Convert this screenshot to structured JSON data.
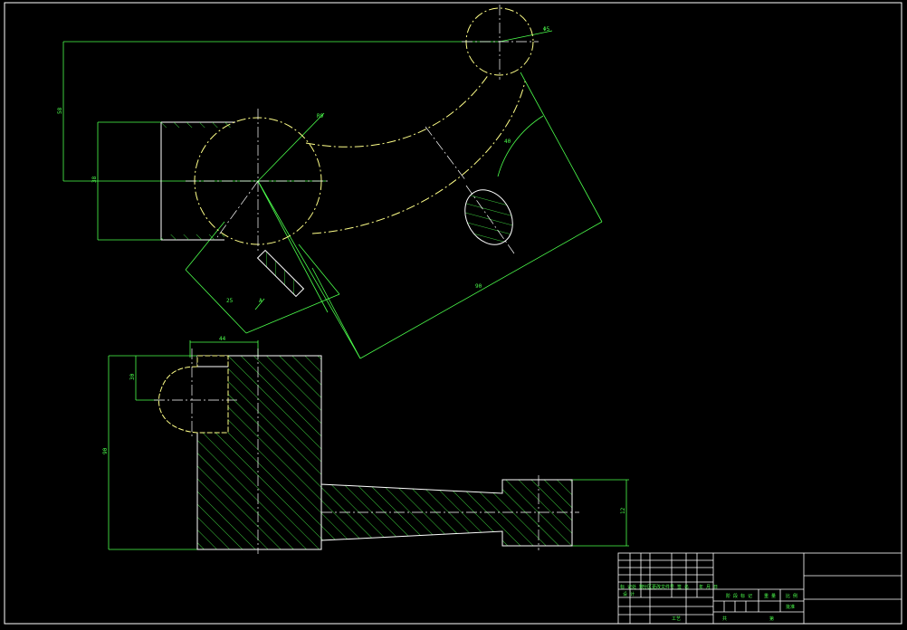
{
  "dimensions": {
    "hole_dia": "Φ5",
    "radius_top": "R9",
    "height_upper": "58",
    "height_boss": "38",
    "angle_arm": "40",
    "length_diag": "90",
    "length_short": "25",
    "view_label": "A",
    "width_top": "44",
    "slot_height": "30",
    "height_lower": "90",
    "shaft_dia": "12"
  },
  "title_block": {
    "row_labels": [
      "标 记",
      "处 数",
      "分区",
      "更改文件号",
      "签 名",
      "年 月 日"
    ],
    "design_label": "设 计",
    "stage_label": "阶 段 标 记",
    "weight_label": "重 量",
    "scale_label": "比 例",
    "sheet_count": "共",
    "sheet_no": "第",
    "process_label": "工艺",
    "approve_label": "批准"
  },
  "colors": {
    "background": "#000000",
    "frame": "#ffffff",
    "outline": "#ffff88",
    "dimension": "#4cff4c",
    "hatch": "#4cff4c",
    "centerline": "#ffffff"
  }
}
